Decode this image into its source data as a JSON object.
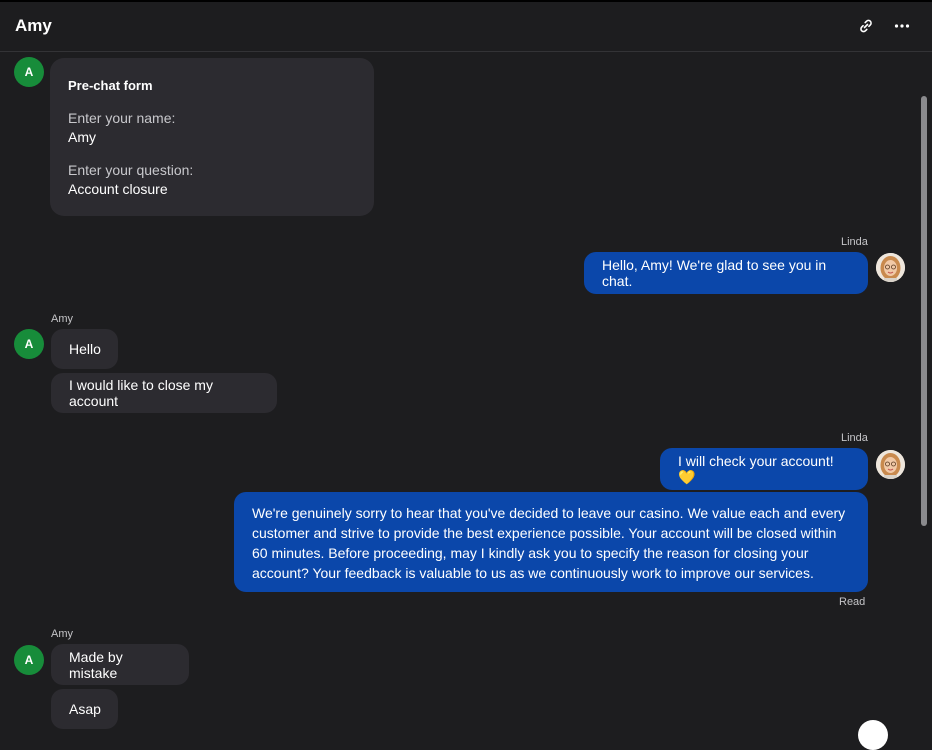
{
  "header": {
    "title": "Amy",
    "link_icon": "link-icon",
    "more_icon": "more-dots-icon"
  },
  "prechat": {
    "avatar_letter": "A",
    "title": "Pre-chat form",
    "name_label": "Enter your name:",
    "name_value": "Amy",
    "question_label": "Enter your question:",
    "question_value": "Account closure"
  },
  "messages": {
    "agent1": {
      "sender": "Linda",
      "text": "Hello, Amy! We're glad to see you in chat."
    },
    "visitor1": {
      "sender": "Amy",
      "avatar_letter": "A",
      "line1": "Hello",
      "line2": "I would like to close my account"
    },
    "agent2": {
      "sender": "Linda",
      "line1": "I will check your account! 💛",
      "line2": "We're genuinely sorry to hear that you've decided to leave our casino. We value each and every customer and strive to provide the best experience possible. Your account will be closed within 60 minutes. Before proceeding, may I kindly ask you to specify the reason for closing your account? Your feedback is valuable to us as we continuously work to improve our services.",
      "status": "Read"
    },
    "visitor2": {
      "sender": "Amy",
      "avatar_letter": "A",
      "line1": "Made by mistake",
      "line2": "Asap"
    }
  },
  "colors": {
    "background": "#1d1d1f",
    "incoming_bubble": "#2c2b30",
    "outgoing_bubble": "#0b47aa",
    "visitor_avatar": "#178c3a"
  }
}
